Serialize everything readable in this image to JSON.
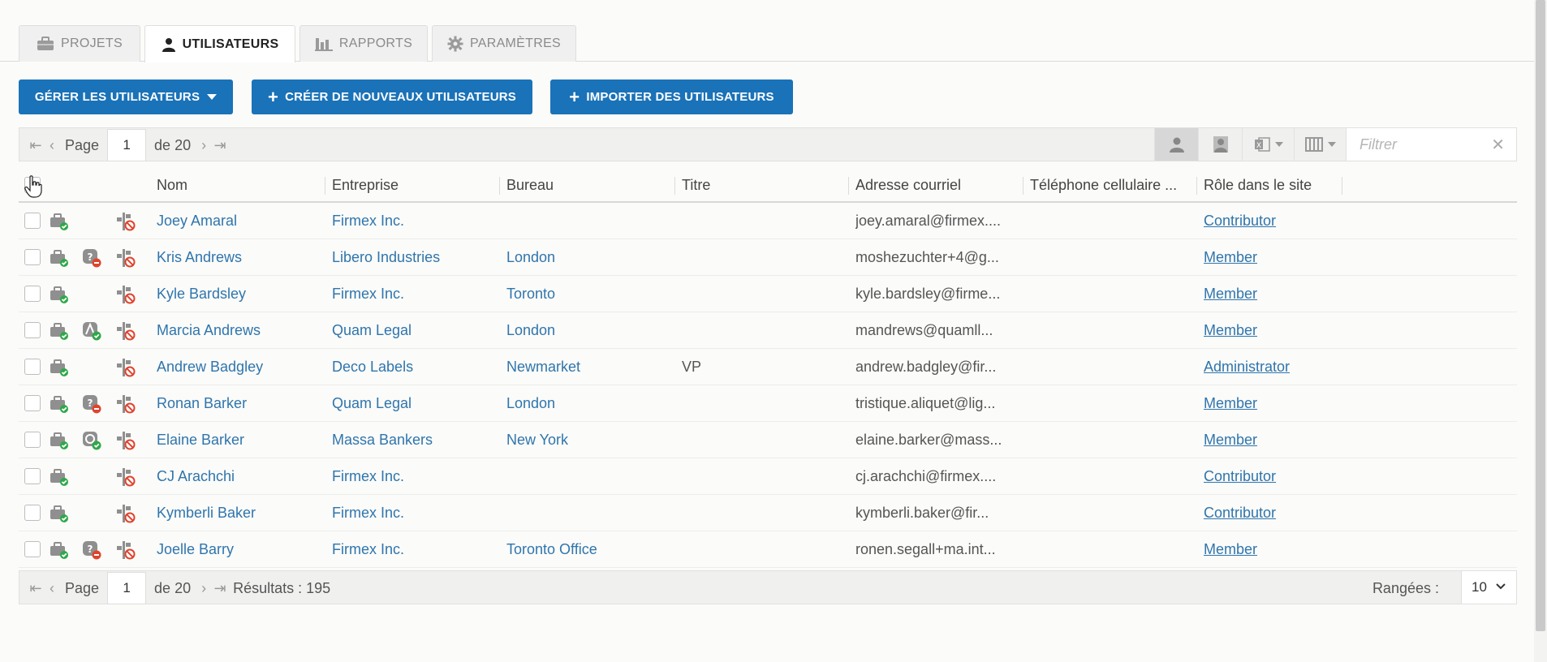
{
  "tabs": [
    {
      "label": "PROJETS",
      "icon": "briefcase-icon",
      "active": false
    },
    {
      "label": "UTILISATEURS",
      "icon": "user-icon",
      "active": true
    },
    {
      "label": "RAPPORTS",
      "icon": "bar-chart-icon",
      "active": false
    },
    {
      "label": "PARAMÈTRES",
      "icon": "gear-icon",
      "active": false
    }
  ],
  "toolbar": {
    "manage_label": "GÉRER LES UTILISATEURS",
    "create_label": "CRÉER DE NOUVEAUX UTILISATEURS",
    "import_label": "IMPORTER DES UTILISATEURS",
    "accent": "#1a72b8"
  },
  "pager_top": {
    "page_label": "Page",
    "page_value": "1",
    "of_label": "de 20"
  },
  "filter": {
    "placeholder": "Filtrer"
  },
  "columns": {
    "name": "Nom",
    "company": "Entreprise",
    "office": "Bureau",
    "title": "Titre",
    "email": "Adresse courriel",
    "phone": "Téléphone cellulaire ...",
    "role": "Rôle dans le site"
  },
  "users": [
    {
      "name": "Joey Amaral",
      "company": "Firmex Inc.",
      "office": "",
      "title": "",
      "email": "joey.amaral@firmex....",
      "phone": "",
      "role": "Contributor",
      "status": "none"
    },
    {
      "name": "Kris Andrews",
      "company": "Libero Industries",
      "office": "London",
      "title": "",
      "email": "moshezuchter+4@g...",
      "phone": "",
      "role": "Member",
      "status": "blocked"
    },
    {
      "name": "Kyle Bardsley",
      "company": "Firmex Inc.",
      "office": "Toronto",
      "title": "",
      "email": "kyle.bardsley@firme...",
      "phone": "",
      "role": "Member",
      "status": "none"
    },
    {
      "name": "Marcia Andrews",
      "company": "Quam Legal",
      "office": "London",
      "title": "",
      "email": "mandrews@quamll...",
      "phone": "",
      "role": "Member",
      "status": "android"
    },
    {
      "name": "Andrew Badgley",
      "company": "Deco Labels",
      "office": "Newmarket",
      "title": "VP",
      "email": "andrew.badgley@fir...",
      "phone": "",
      "role": "Administrator",
      "status": "none"
    },
    {
      "name": "Ronan Barker",
      "company": "Quam Legal",
      "office": "London",
      "title": "",
      "email": "tristique.aliquet@lig...",
      "phone": "",
      "role": "Member",
      "status": "blocked"
    },
    {
      "name": "Elaine Barker",
      "company": "Massa Bankers",
      "office": "New York",
      "title": "",
      "email": "elaine.barker@mass...",
      "phone": "",
      "role": "Member",
      "status": "approved"
    },
    {
      "name": "CJ Arachchi",
      "company": "Firmex Inc.",
      "office": "",
      "title": "",
      "email": "cj.arachchi@firmex....",
      "phone": "",
      "role": "Contributor",
      "status": "none"
    },
    {
      "name": "Kymberli Baker",
      "company": "Firmex Inc.",
      "office": "",
      "title": "",
      "email": "kymberli.baker@fir...",
      "phone": "",
      "role": "Contributor",
      "status": "none"
    },
    {
      "name": "Joelle Barry",
      "company": "Firmex Inc.",
      "office": "Toronto Office",
      "title": "",
      "email": "ronen.segall+ma.int...",
      "phone": "",
      "role": "Member",
      "status": "blocked"
    }
  ],
  "pager_bottom": {
    "page_label": "Page",
    "page_value": "1",
    "of_label": "de 20",
    "results_label": "Résultats : 195",
    "rows_label": "Rangées :",
    "rows_value": "10"
  }
}
